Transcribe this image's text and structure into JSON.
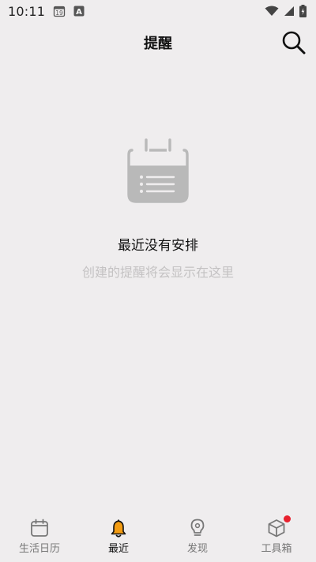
{
  "status_bar": {
    "time": "10:11",
    "calendar_day": "19",
    "notification_letter": "A",
    "icons": [
      "calendar-notification-icon",
      "app-notification-icon",
      "wifi-icon",
      "signal-icon",
      "battery-icon"
    ]
  },
  "header": {
    "title": "提醒",
    "search_icon": "search-icon"
  },
  "empty_state": {
    "icon": "calendar-list-icon",
    "title": "最近没有安排",
    "subtitle": "创建的提醒将会显示在这里"
  },
  "bottom_nav": {
    "active_index": 1,
    "active_color": "#f39c12",
    "badge_color": "#e8212e",
    "items": [
      {
        "label": "生活日历",
        "icon": "calendar-icon"
      },
      {
        "label": "最近",
        "icon": "bell-icon"
      },
      {
        "label": "发现",
        "icon": "lightbulb-icon"
      },
      {
        "label": "工具箱",
        "icon": "box-icon",
        "badge": true
      }
    ]
  }
}
